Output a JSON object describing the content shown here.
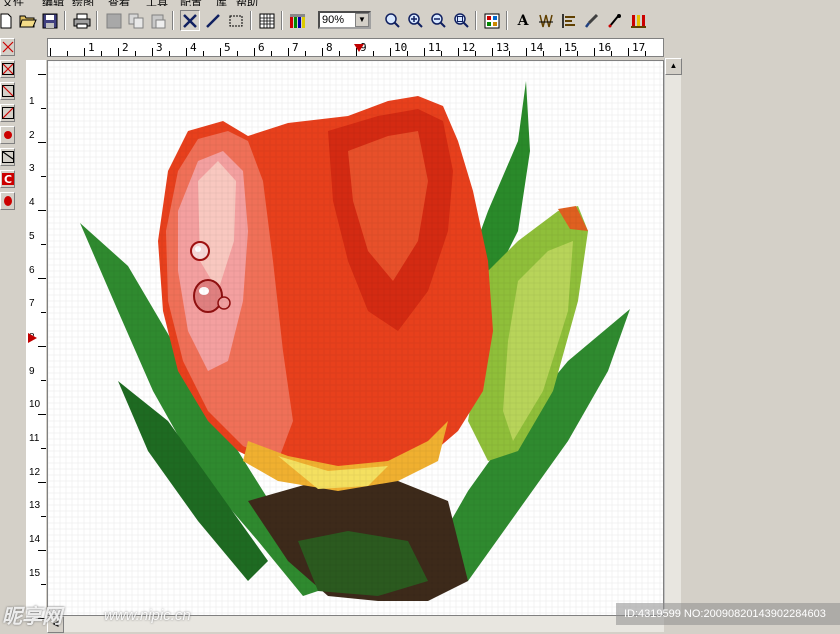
{
  "menu": {
    "items": [
      "文件",
      "编辑",
      "绘图",
      "查看",
      "工具",
      "配置",
      "库",
      "帮助"
    ]
  },
  "toolbar": {
    "zoom_value": "90%",
    "text_tool_label": "A",
    "buttons": [
      "new-file-icon",
      "open-folder-icon",
      "save-icon",
      "print-icon",
      "grey-block-icon",
      "copy-icon",
      "paste-icon",
      "cross-stitch-icon",
      "half-stitch-icon",
      "select-icon",
      "grid-icon",
      "palette-icon",
      "zoom-icon",
      "zoom-in-icon",
      "zoom-out-icon",
      "zoom-fit-icon",
      "color-chart-icon",
      "text-icon",
      "backstitch-icon",
      "align-icon",
      "eyedropper-brush-icon",
      "dropper-icon",
      "thread-icon"
    ]
  },
  "ruler": {
    "horizontal": [
      "1",
      "2",
      "3",
      "4",
      "5",
      "6",
      "7",
      "8",
      "9",
      "10",
      "11",
      "12",
      "13",
      "14",
      "15",
      "16",
      "17"
    ],
    "vertical": [
      "1",
      "2",
      "3",
      "4",
      "5",
      "6",
      "7",
      "8",
      "9",
      "10",
      "11",
      "12",
      "13",
      "14",
      "15"
    ]
  },
  "watermark": {
    "brand": "昵享网",
    "url": "www.nipic.cn",
    "id_text": "ID:4319599 NO:20090820143902284603"
  },
  "colors": {
    "canvas": "#ffffff",
    "chrome": "#d4d0c8",
    "accent_red": "#cc0000"
  }
}
